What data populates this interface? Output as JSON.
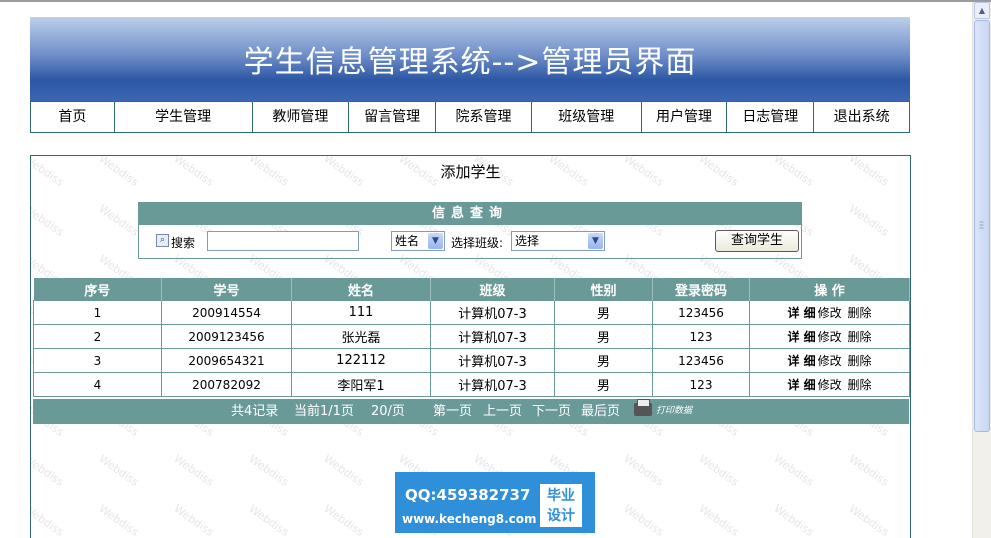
{
  "header": {
    "title": "学生信息管理系统-->管理员界面"
  },
  "nav": [
    {
      "label": "首页"
    },
    {
      "label": "学生管理"
    },
    {
      "label": "教师管理"
    },
    {
      "label": "留言管理"
    },
    {
      "label": "院系管理"
    },
    {
      "label": "班级管理"
    },
    {
      "label": "用户管理"
    },
    {
      "label": "日志管理"
    },
    {
      "label": "退出系统"
    }
  ],
  "panel": {
    "title": "添加学生"
  },
  "search": {
    "header": "信息查询",
    "label": "搜索",
    "input_value": "",
    "field_select": "姓名",
    "class_label": "选择班级:",
    "class_select": "选择",
    "button": "查询学生"
  },
  "table": {
    "columns": [
      "序号",
      "学号",
      "姓名",
      "班级",
      "性别",
      "登录密码",
      "操 作"
    ],
    "rows": [
      {
        "no": "1",
        "id": "200914554",
        "name": "111",
        "class": "计算机07-3",
        "gender": "男",
        "password": "123456"
      },
      {
        "no": "2",
        "id": "2009123456",
        "name": "张光磊",
        "class": "计算机07-3",
        "gender": "男",
        "password": "123"
      },
      {
        "no": "3",
        "id": "2009654321",
        "name": "122112",
        "class": "计算机07-3",
        "gender": "男",
        "password": "123456"
      },
      {
        "no": "4",
        "id": "200782092",
        "name": "李阳军1",
        "class": "计算机07-3",
        "gender": "男",
        "password": "123"
      }
    ],
    "actions": {
      "detail": "详 细",
      "edit": "修改",
      "delete": "删除"
    }
  },
  "pager": {
    "total": "共4记录",
    "current": "当前1/1页",
    "per_page": "20/页",
    "first": "第一页",
    "prev": "上一页",
    "next": "下一页",
    "last": "最后页",
    "print": "打印数据"
  },
  "ad": {
    "qq": "QQ:459382737",
    "url": "www.kecheng8.com",
    "badge_line1": "毕业",
    "badge_line2": "设计"
  },
  "watermark": "Webdiss"
}
